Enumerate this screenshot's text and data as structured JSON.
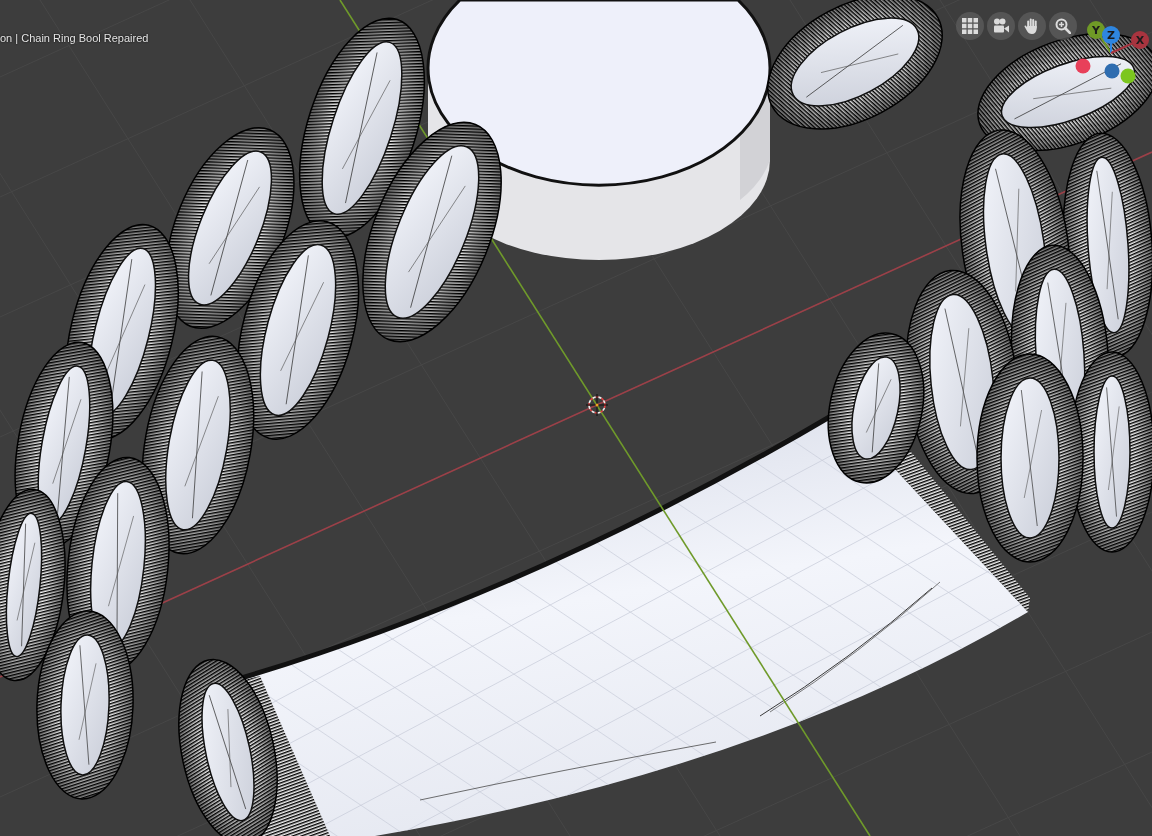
{
  "viewport": {
    "info_text": "on | Chain Ring Bool Repaired"
  },
  "gizmo": {
    "axes": [
      {
        "label": "Y",
        "color": "#6f9a26"
      },
      {
        "label": "Z",
        "color": "#2e86e0"
      },
      {
        "label": "X",
        "color": "#a8343f"
      }
    ],
    "negative_axes": [
      {
        "color": "#e8405a"
      },
      {
        "color": "#2f6db0"
      },
      {
        "color": "#7cc61f"
      }
    ]
  }
}
